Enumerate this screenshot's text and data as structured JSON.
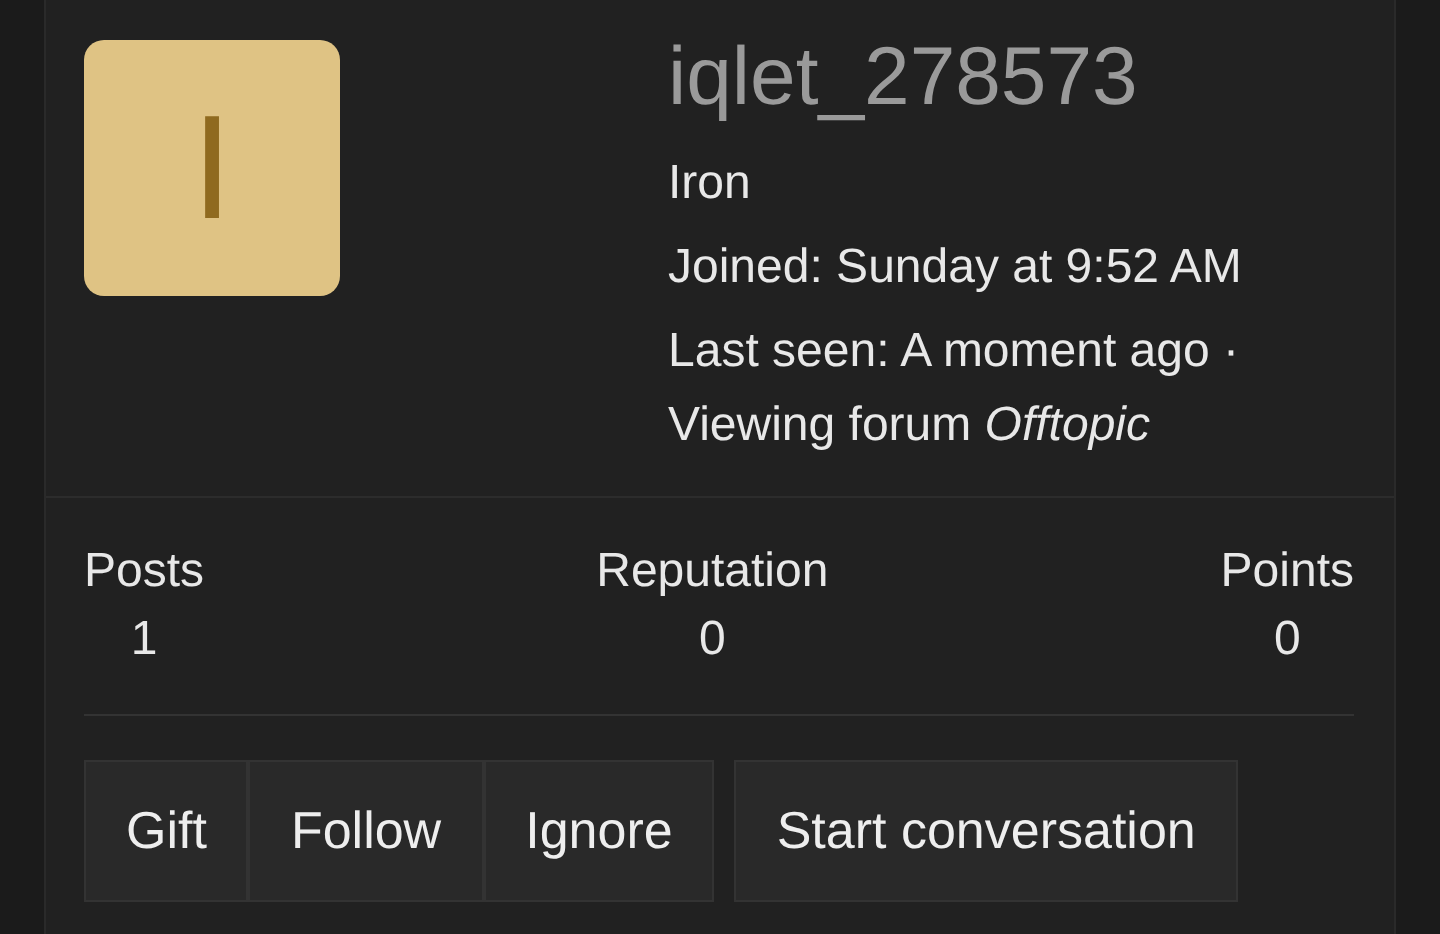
{
  "profile": {
    "avatar_letter": "I",
    "username": "iqlet_278573",
    "user_title": "Iron",
    "joined": "Joined: Sunday at 9:52 AM",
    "last_seen": "Last seen: A moment ago · Viewing forum *Offtopic*"
  },
  "stats": [
    {
      "label": "Posts",
      "value": "1"
    },
    {
      "label": "Reputation",
      "value": "0"
    },
    {
      "label": "Points",
      "value": "0"
    }
  ],
  "button_groups": [
    [
      "Gift",
      "Follow",
      "Ignore"
    ],
    [
      "Start conversation"
    ]
  ]
}
